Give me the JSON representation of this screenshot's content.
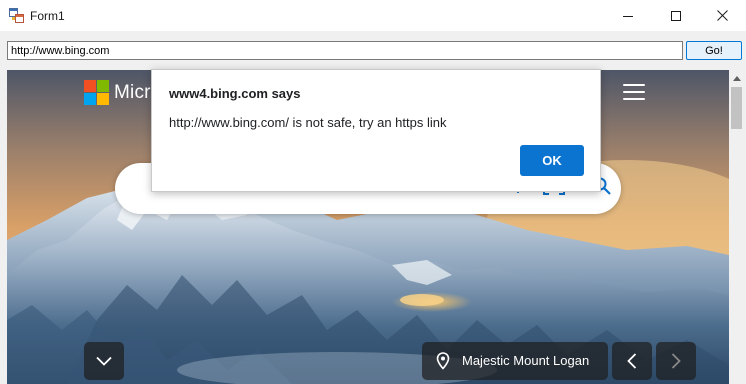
{
  "window": {
    "title": "Form1"
  },
  "toolbar": {
    "url_value": "http://www.bing.com",
    "go_label": "Go!"
  },
  "bing": {
    "brand_partial": "Micr",
    "location_label": "Majestic Mount Logan"
  },
  "dialog": {
    "title": "www4.bing.com says",
    "message": "http://www.bing.com/ is not safe, try an https link",
    "ok_label": "OK"
  },
  "colors": {
    "accent": "#0b73d0",
    "go_border": "#0078d7"
  },
  "icons": {
    "app": "winforms-app-icon",
    "minimize": "minimize-icon",
    "maximize": "maximize-icon",
    "close": "close-icon",
    "menu": "hamburger-menu-icon",
    "scroll_down": "chevron-down-icon",
    "location": "location-pin-icon",
    "previous": "chevron-left-icon",
    "next": "chevron-right-icon"
  }
}
